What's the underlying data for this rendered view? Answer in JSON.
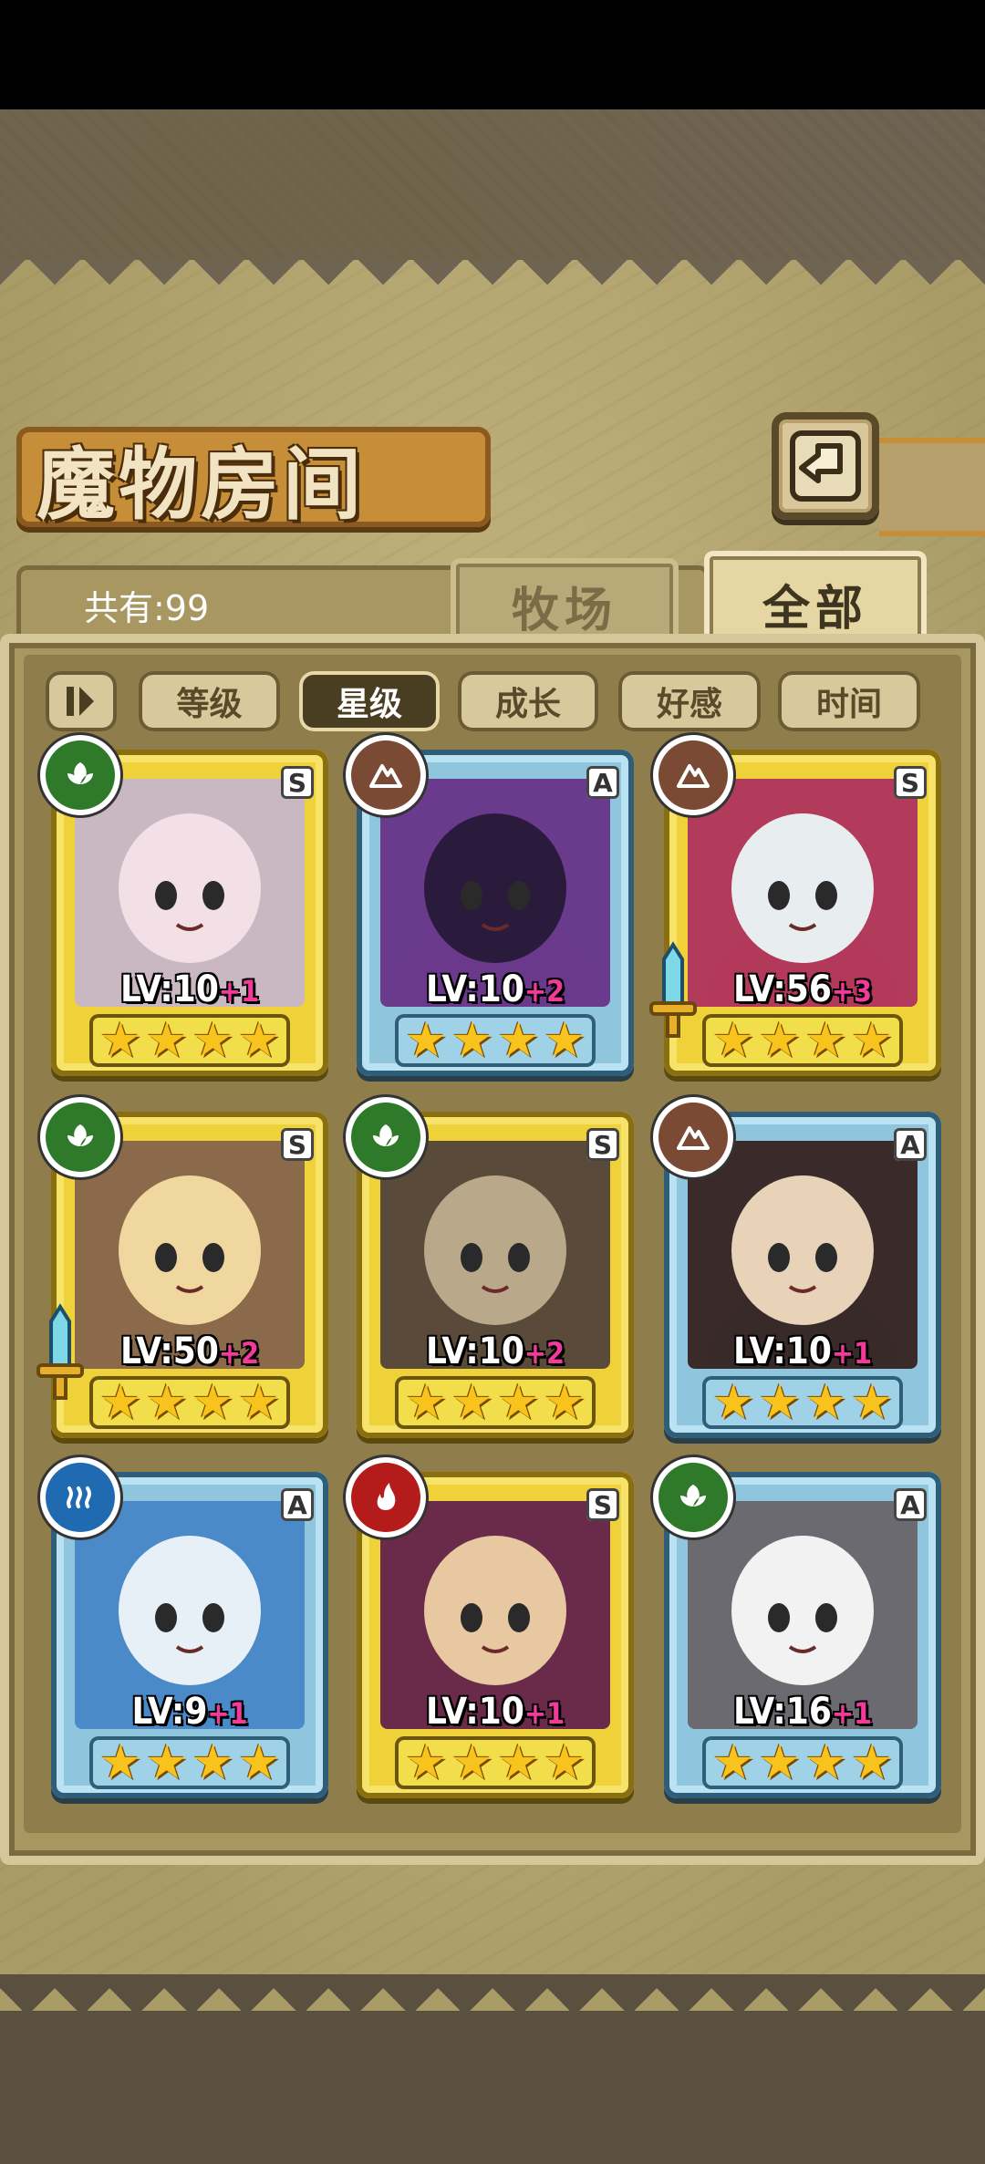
{
  "title": "魔物房间",
  "count": "共有:99",
  "tabs": {
    "ranch": "牧场",
    "all": "全部"
  },
  "sort": {
    "level": "等级",
    "star": "星级",
    "growth": "成长",
    "favor": "好感",
    "time": "时间",
    "active": "星级"
  },
  "colors": {
    "gold_frame": "#efd23a",
    "blue_frame": "#8fc6dd",
    "plus": "#f23a9a",
    "star": "#f7c31c"
  },
  "monsters": [
    {
      "rank": "S",
      "element": "nature-icon",
      "frame": "gold",
      "lv": "LV:10",
      "plus": "+1",
      "stars": 4
    },
    {
      "rank": "A",
      "element": "earth-icon",
      "frame": "blue",
      "lv": "LV:10",
      "plus": "+2",
      "stars": 4
    },
    {
      "rank": "S",
      "element": "earth-icon",
      "frame": "gold",
      "lv": "LV:56",
      "plus": "+3",
      "stars": 4,
      "equipped": true
    },
    {
      "rank": "S",
      "element": "nature-icon",
      "frame": "gold",
      "lv": "LV:50",
      "plus": "+2",
      "stars": 4,
      "equipped": true
    },
    {
      "rank": "S",
      "element": "nature-icon",
      "frame": "gold",
      "lv": "LV:10",
      "plus": "+2",
      "stars": 4
    },
    {
      "rank": "A",
      "element": "earth-icon",
      "frame": "blue",
      "lv": "LV:10",
      "plus": "+1",
      "stars": 4
    },
    {
      "rank": "A",
      "element": "water-icon",
      "frame": "blue",
      "lv": "LV:9",
      "plus": "+1",
      "stars": 4
    },
    {
      "rank": "S",
      "element": "fire-icon",
      "frame": "gold",
      "lv": "LV:10",
      "plus": "+1",
      "stars": 4
    },
    {
      "rank": "A",
      "element": "nature-icon",
      "frame": "blue",
      "lv": "LV:16",
      "plus": "+1",
      "stars": 4
    }
  ]
}
